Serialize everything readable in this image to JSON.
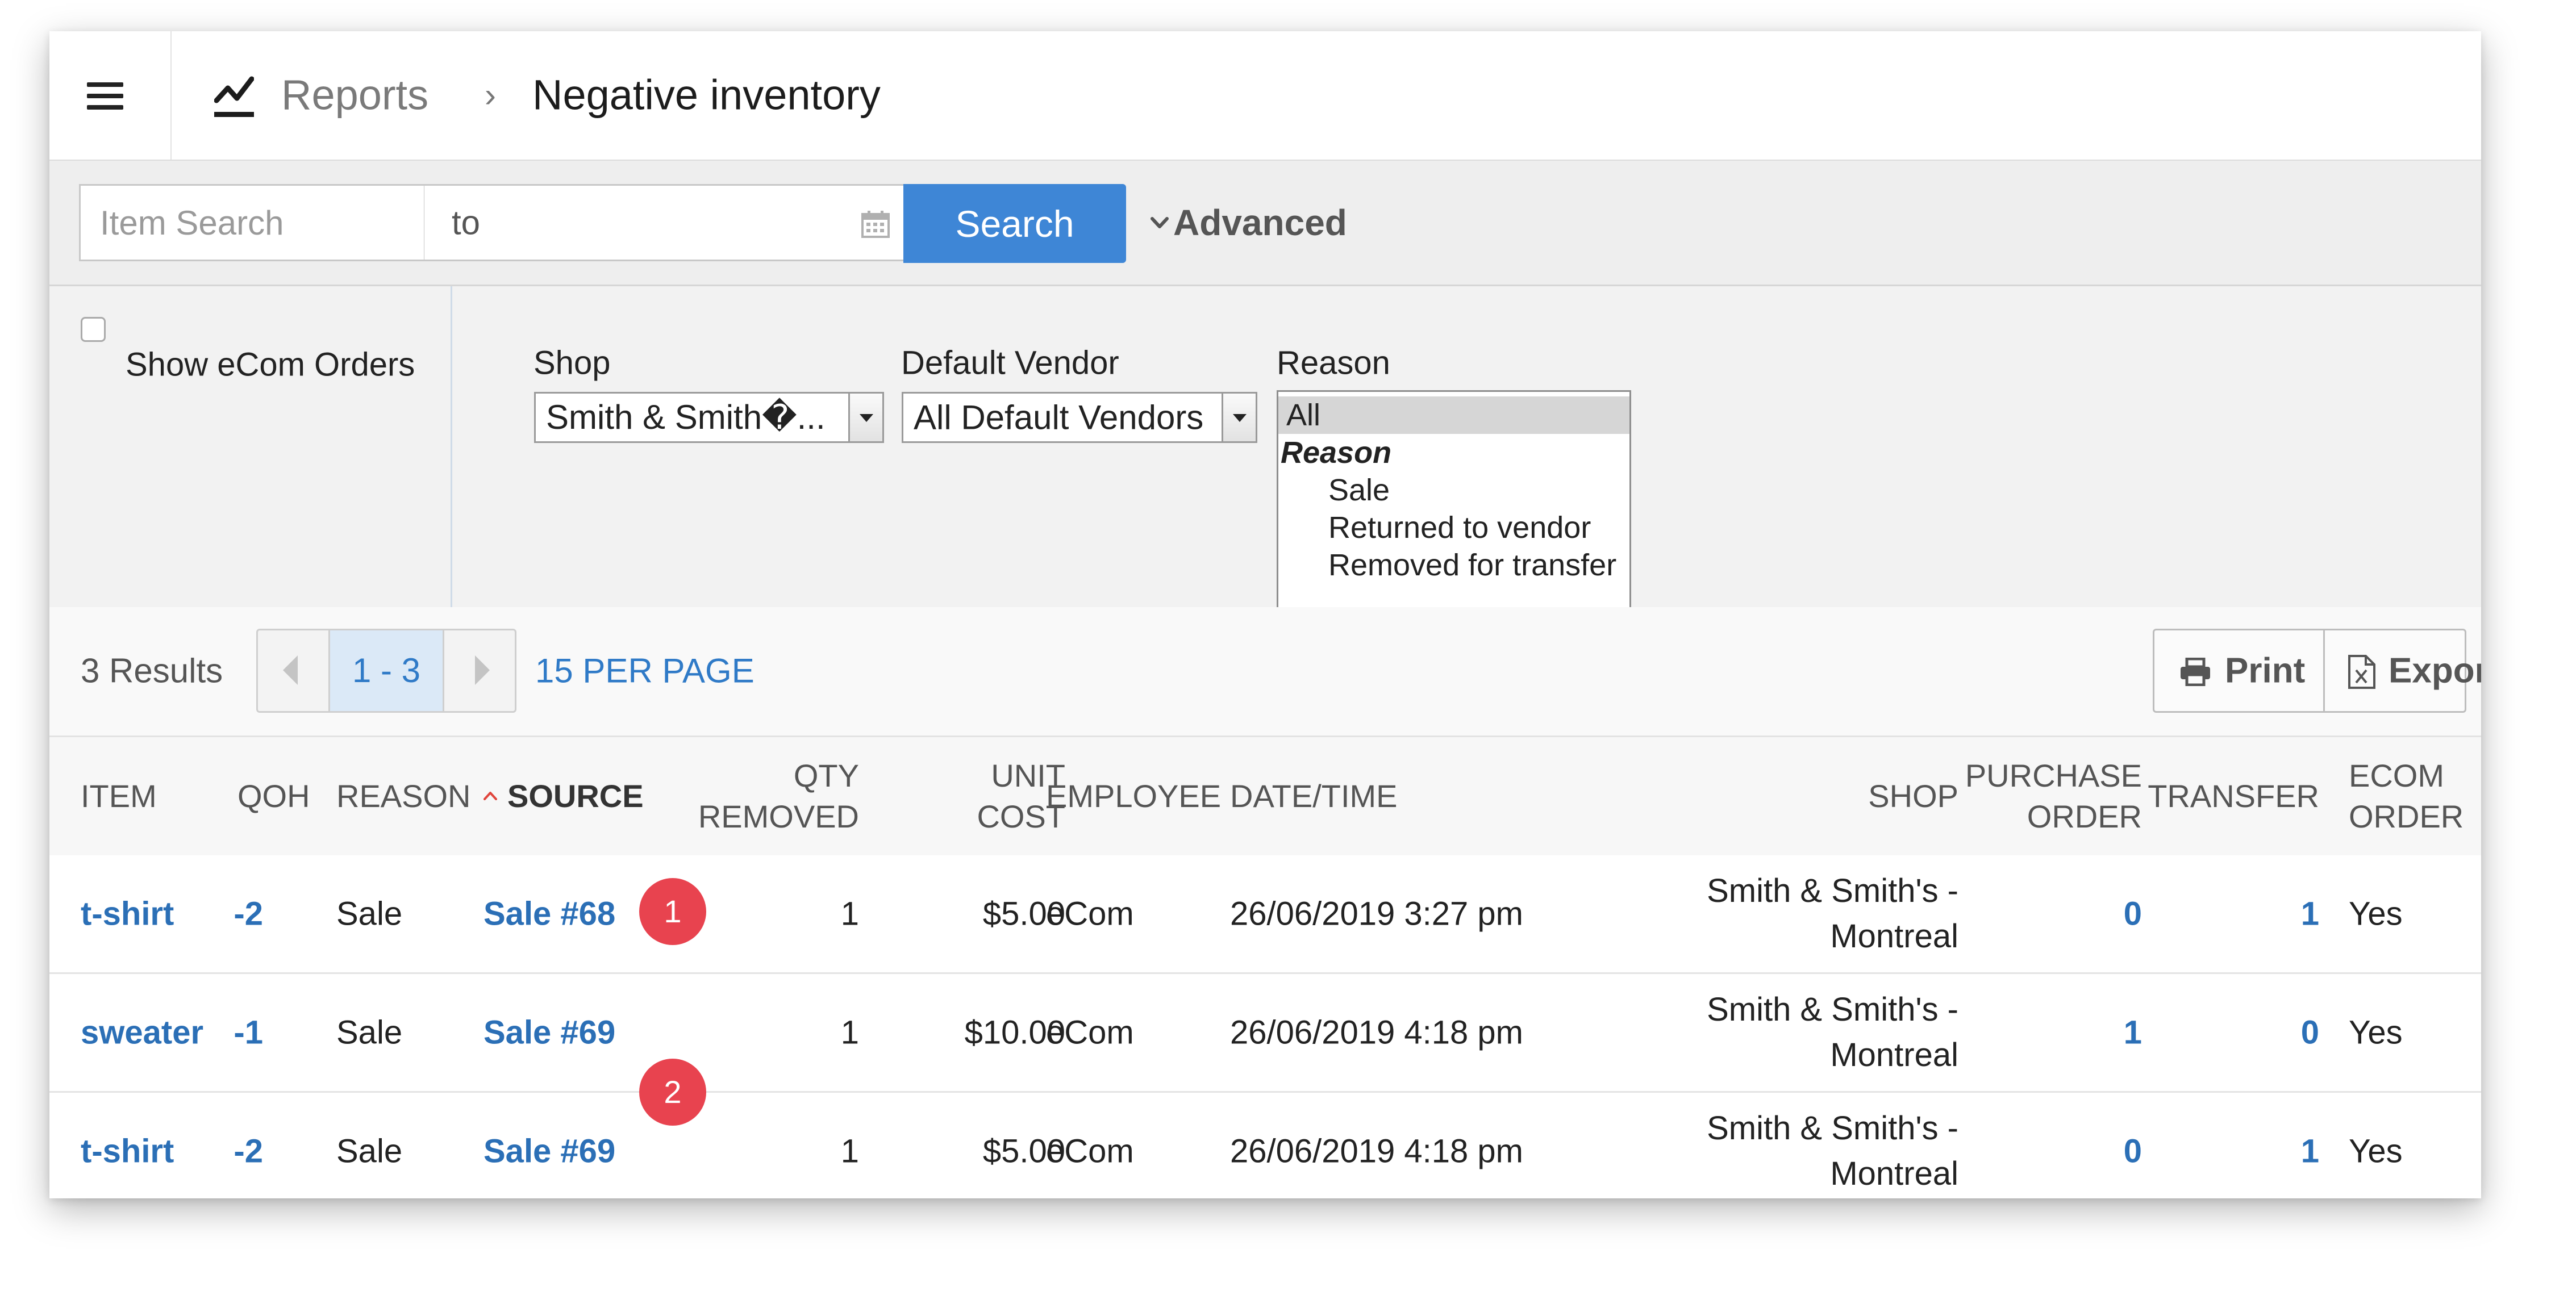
{
  "header": {
    "breadcrumb_parent": "Reports",
    "breadcrumb_separator": "›",
    "title": "Negative inventory"
  },
  "search": {
    "item_placeholder": "Item Search",
    "date_to_label": "to",
    "search_button": "Search",
    "advanced_label": "Advanced"
  },
  "filters": {
    "show_ecom_label": "Show eCom Orders",
    "show_ecom_checked": false,
    "shop_label": "Shop",
    "shop_value": "Smith & Smith�...",
    "vendor_label": "Default Vendor",
    "vendor_value": "All Default Vendors",
    "reason_label": "Reason",
    "reason_options": [
      {
        "label": "All",
        "selected": true,
        "group": false
      },
      {
        "label": "Reason",
        "selected": false,
        "group": true
      },
      {
        "label": "Sale",
        "selected": false,
        "group": false
      },
      {
        "label": "Returned to vendor",
        "selected": false,
        "group": false
      },
      {
        "label": "Removed for transfer",
        "selected": false,
        "group": false
      }
    ]
  },
  "results": {
    "count_label": "3 Results",
    "page_range": "1 - 3",
    "per_page": "15 PER PAGE",
    "print_label": "Print",
    "export_label": "Export"
  },
  "table": {
    "columns": {
      "item": "ITEM",
      "qoh": "QOH",
      "reason": "REASON",
      "source": "SOURCE",
      "qty_removed_1": "QTY",
      "qty_removed_2": "REMOVED",
      "unit_cost_1": "UNIT",
      "unit_cost_2": "COST",
      "employee": "EMPLOYEE",
      "datetime": "DATE/TIME",
      "shop": "SHOP",
      "purchase_order_1": "PURCHASE",
      "purchase_order_2": "ORDER",
      "transfer": "TRANSFER",
      "ecom_order_1": "ECOM",
      "ecom_order_2": "ORDER"
    },
    "rows": [
      {
        "item": "t-shirt",
        "qoh": "-2",
        "reason": "Sale",
        "source": "Sale #68",
        "qty_removed": "1",
        "unit_cost": "$5.00",
        "employee": "eCom",
        "datetime": "26/06/2019 3:27 pm",
        "shop_line1": "Smith & Smith's -",
        "shop_line2": "Montreal",
        "purchase_order": "0",
        "transfer": "1",
        "ecom_order": "Yes"
      },
      {
        "item": "sweater",
        "qoh": "-1",
        "reason": "Sale",
        "source": "Sale #69",
        "qty_removed": "1",
        "unit_cost": "$10.00",
        "employee": "eCom",
        "datetime": "26/06/2019 4:18 pm",
        "shop_line1": "Smith & Smith's -",
        "shop_line2": "Montreal",
        "purchase_order": "1",
        "transfer": "0",
        "ecom_order": "Yes"
      },
      {
        "item": "t-shirt",
        "qoh": "-2",
        "reason": "Sale",
        "source": "Sale #69",
        "qty_removed": "1",
        "unit_cost": "$5.00",
        "employee": "eCom",
        "datetime": "26/06/2019 4:18 pm",
        "shop_line1": "Smith & Smith's -",
        "shop_line2": "Montreal",
        "purchase_order": "0",
        "transfer": "1",
        "ecom_order": "Yes"
      }
    ]
  },
  "annotations": {
    "marker_1": "1",
    "marker_2": "2"
  },
  "colors": {
    "accent_blue": "#3e86d6",
    "link_blue": "#2b6fb6",
    "marker_red": "#e8434f",
    "sort_arrow": "#e0453c"
  },
  "icons": {
    "menu": "hamburger-icon",
    "report": "trend-chart-icon",
    "calendar": "calendar-icon",
    "advanced": "chevron-down-icon",
    "print": "printer-icon",
    "export": "excel-file-icon",
    "sort": "sort-ascending-icon"
  }
}
